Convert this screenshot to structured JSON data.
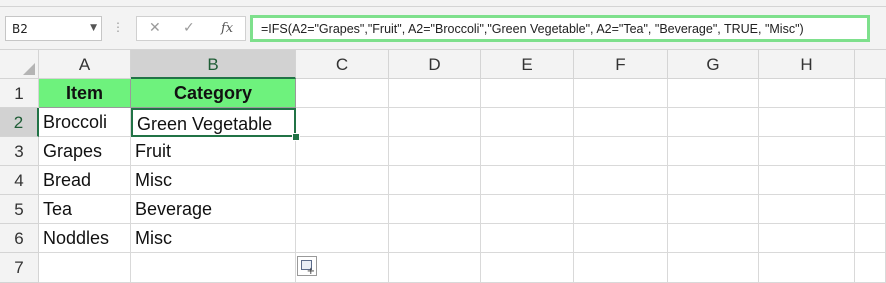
{
  "name_box": {
    "value": "B2"
  },
  "formula_bar": {
    "cancel_icon": "close-icon",
    "enter_icon": "checkmark-icon",
    "fx_label": "fx",
    "formula": "=IFS(A2=\"Grapes\",\"Fruit\", A2=\"Broccoli\",\"Green Vegetable\", A2=\"Tea\", \"Beverage\", TRUE, \"Misc\")"
  },
  "columns": [
    "A",
    "B",
    "C",
    "D",
    "E",
    "F",
    "G",
    "H"
  ],
  "rows": [
    "1",
    "2",
    "3",
    "4",
    "5",
    "6",
    "7"
  ],
  "cells": {
    "A1": "Item",
    "B1": "Category",
    "A2": "Broccoli",
    "B2": "Green Vegetable",
    "A3": "Grapes",
    "B3": "Fruit",
    "A4": "Bread",
    "B4": "Misc",
    "A5": "Tea",
    "B5": "Beverage",
    "A6": "Noddles",
    "B6": "Misc"
  },
  "selection": {
    "cell": "B2"
  },
  "colors": {
    "header_fill": "#6ef27d",
    "formula_highlight": "#7ee08c",
    "selection": "#217346"
  }
}
